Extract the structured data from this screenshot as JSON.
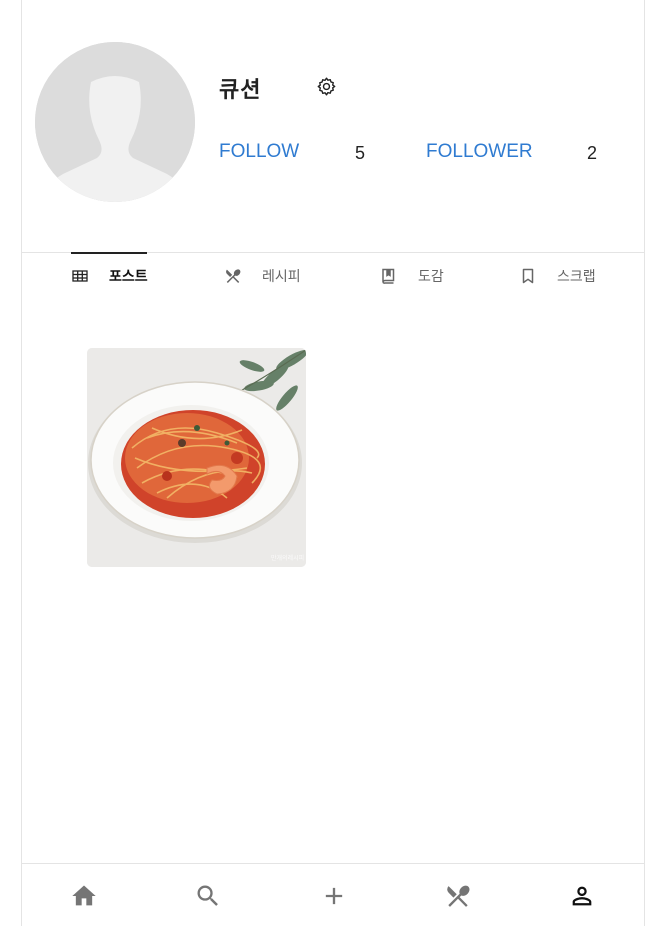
{
  "profile": {
    "username": "큐션",
    "follow_label": "FOLLOW",
    "follow_count": "5",
    "follower_label": "FOLLOWER",
    "follower_count": "2"
  },
  "tabs": [
    {
      "label": "포스트",
      "icon": "grid-icon",
      "active": true
    },
    {
      "label": "레시피",
      "icon": "utensils-icon",
      "active": false
    },
    {
      "label": "도감",
      "icon": "book-icon",
      "active": false
    },
    {
      "label": "스크랩",
      "icon": "bookmark-icon",
      "active": false
    }
  ],
  "posts": [
    {
      "alt": "tomato shrimp pasta photo",
      "watermark": "만개의레시피"
    }
  ],
  "bottom_nav": [
    {
      "icon": "home-icon",
      "active": false
    },
    {
      "icon": "search-icon",
      "active": false
    },
    {
      "icon": "add-icon",
      "active": false
    },
    {
      "icon": "utensils-icon",
      "active": false
    },
    {
      "icon": "profile-icon",
      "active": true
    }
  ],
  "colors": {
    "link": "#2f7bd1",
    "text": "#222222",
    "muted": "#666666",
    "icon_inactive": "#757575",
    "icon_active": "#111111",
    "avatar_bg": "#dcdcdc",
    "divider": "#e4e4e4"
  }
}
